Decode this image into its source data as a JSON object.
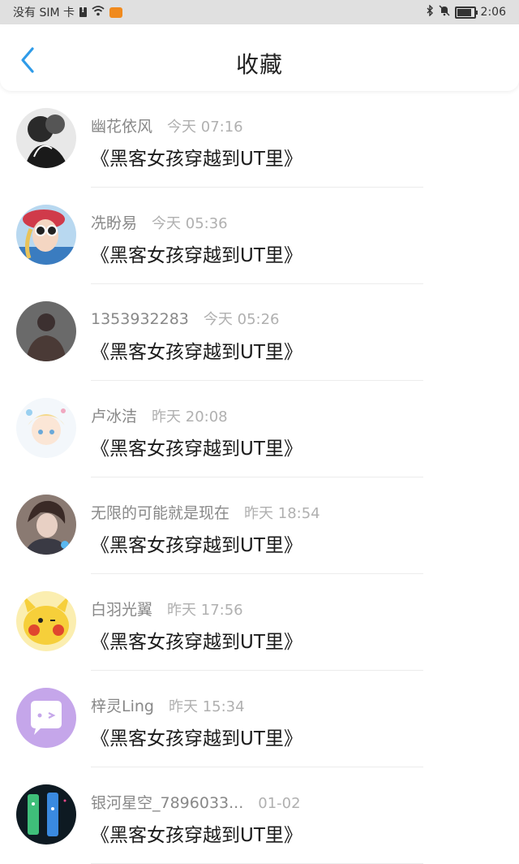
{
  "status_bar": {
    "left_text": "没有 SIM 卡",
    "time": "2:06",
    "icons": [
      "sim-alert-icon",
      "wifi-icon",
      "game-icon",
      "bluetooth-icon",
      "mute-icon",
      "battery-icon"
    ],
    "battery_level": 0.8
  },
  "header": {
    "title": "收藏",
    "back_icon": "chevron-left-icon",
    "accent_color": "#2f9be8"
  },
  "items": [
    {
      "name": "幽花依风",
      "time": "今天 07:16",
      "title": "《黑客女孩穿越到UT里》"
    },
    {
      "name": "冼盼易",
      "time": "今天 05:36",
      "title": "《黑客女孩穿越到UT里》"
    },
    {
      "name": "1353932283",
      "time": "今天 05:26",
      "title": "《黑客女孩穿越到UT里》"
    },
    {
      "name": "卢冰洁",
      "time": "昨天 20:08",
      "title": "《黑客女孩穿越到UT里》"
    },
    {
      "name": "无限的可能就是现在",
      "time": "昨天 18:54",
      "title": "《黑客女孩穿越到UT里》"
    },
    {
      "name": "白羽光翼",
      "time": "昨天 17:56",
      "title": "《黑客女孩穿越到UT里》"
    },
    {
      "name": "梓灵Ling",
      "time": "昨天 15:34",
      "title": "《黑客女孩穿越到UT里》"
    },
    {
      "name": "银河星空_7896033...",
      "time": "01-02",
      "title": "《黑客女孩穿越到UT里》"
    }
  ]
}
